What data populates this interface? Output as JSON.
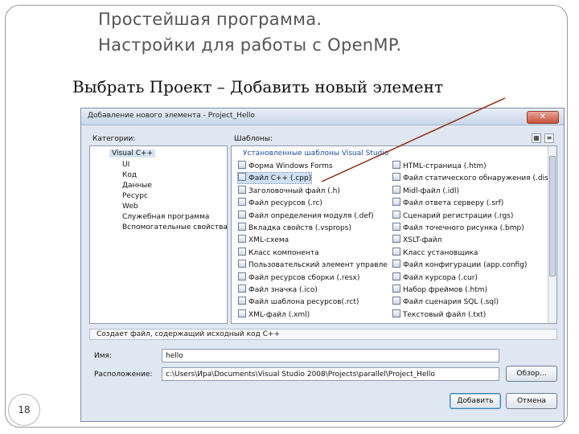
{
  "slide": {
    "title_line1": "Простейшая программа.",
    "title_line2": "Настройки для работы с OpenMP.",
    "subtitle": "Выбрать Проект – Добавить новый элемент",
    "page_number": "18"
  },
  "dialog": {
    "title": "Добавление нового элемента - Project_Hello",
    "close_glyph": "✕",
    "categories_label": "Категории:",
    "templates_label": "Шаблоны:",
    "categories": [
      "Visual C++",
      "UI",
      "Код",
      "Данные",
      "Ресурс",
      "Web",
      "Служебная программа",
      "Вспомогательные свойства"
    ],
    "templates_group": "Установленные шаблоны Visual Studio",
    "templates_left": [
      "Форма Windows Forms",
      "Файл C++ (.cpp)",
      "Заголовочный файл (.h)",
      "Файл ресурсов (.rc)",
      "Файл определения модуля (.def)",
      "Вкладка свойств (.vsprops)",
      "XML-схема",
      "Класс компонента",
      "Пользовательский элемент управле",
      "Файл ресурсов сборки (.resx)",
      "Файл значка (.ico)",
      "Файл шаблона ресурсов(.rct)",
      "XML-файл (.xml)"
    ],
    "templates_right": [
      "HTML-страница (.htm)",
      "Файл статического обнаружения (.dis",
      "Midl-файл (.idl)",
      "Файл ответа серверу (.srf)",
      "Сценарий регистрации (.rgs)",
      "Файл точечного рисунка (.bmp)",
      "XSLT-файл",
      "Класс установщика",
      "Файл конфигурации (app.config)",
      "Файл курсора (.cur)",
      "Набор фреймов (.htm)",
      "Файл сценария SQL (.sql)",
      "Текстовый файл (.txt)"
    ],
    "description": "Создает файл, содержащий исходный код C++",
    "name_label": "Имя:",
    "name_value": "hello",
    "location_label": "Расположение:",
    "location_value": "c:\\Users\\Ира\\Documents\\Visual Studio 2008\\Projects\\parallel\\Project_Hello",
    "browse_label": "Обзор...",
    "add_label": "Добавить",
    "cancel_label": "Отмена"
  },
  "colors": {
    "dialog_bg": "#dfe7f2",
    "arrow": "#8b2a10",
    "group_text": "#1e50a2"
  }
}
